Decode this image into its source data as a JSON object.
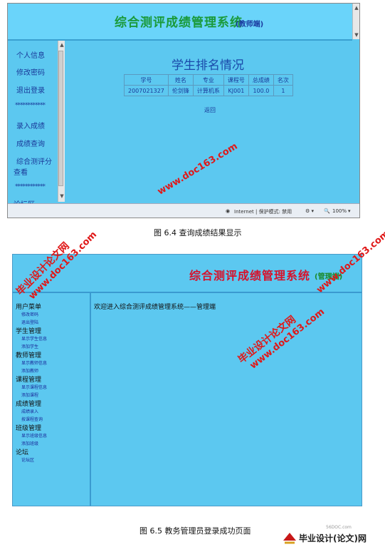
{
  "figure1": {
    "header_title": "综合测评成绩管理系统",
    "header_subtitle": "(教师端)",
    "nav": [
      "个人信息",
      "修改密码",
      "退出登录",
      "************",
      "录入成绩",
      "成绩查询",
      "综合测评分",
      "查看",
      "************",
      "论坛区"
    ],
    "main_title": "学生排名情况",
    "table": {
      "headers": [
        "学号",
        "姓名",
        "专业",
        "课程号",
        "总成绩",
        "名次"
      ],
      "rows": [
        [
          "2007021327",
          "伦剑锋",
          "计算机系",
          "KJ001",
          "100.0",
          "1"
        ]
      ]
    },
    "back_link": "返回",
    "status": {
      "zone": "Internet | 保护模式: 禁用",
      "zoom": "100%"
    },
    "caption": "图 6.4  查询成绩结果显示"
  },
  "figure2": {
    "header_title": "综合测评成绩管理系统",
    "header_subtitle": "(管理端)",
    "nav": [
      {
        "heading": "用户菜单",
        "items": [
          "修改密码",
          "退出登陆"
        ]
      },
      {
        "heading": "学生管理",
        "items": [
          "显示学生信息",
          "添加学生"
        ]
      },
      {
        "heading": "教师管理",
        "items": [
          "显示教师信息",
          "添加教师"
        ]
      },
      {
        "heading": "课程管理",
        "items": [
          "显示课程信息",
          "添加课程"
        ]
      },
      {
        "heading": "成绩管理",
        "items": [
          "成绩录入",
          "按课程查询"
        ]
      },
      {
        "heading": "班级管理",
        "items": [
          "显示班级信息",
          "添加班级"
        ]
      },
      {
        "heading": "论坛",
        "items": [
          "论坛区"
        ]
      }
    ],
    "welcome": "欢迎进入综合测评成绩管理系统——管理端",
    "caption": "图 6.5 教务管理员登录成功页面"
  },
  "watermarks": {
    "line1": "毕业设计论文网",
    "line2": "www.doc163.com"
  },
  "footer_logo": {
    "site": "56DOC.com",
    "text": "毕业设计(论文)网"
  }
}
